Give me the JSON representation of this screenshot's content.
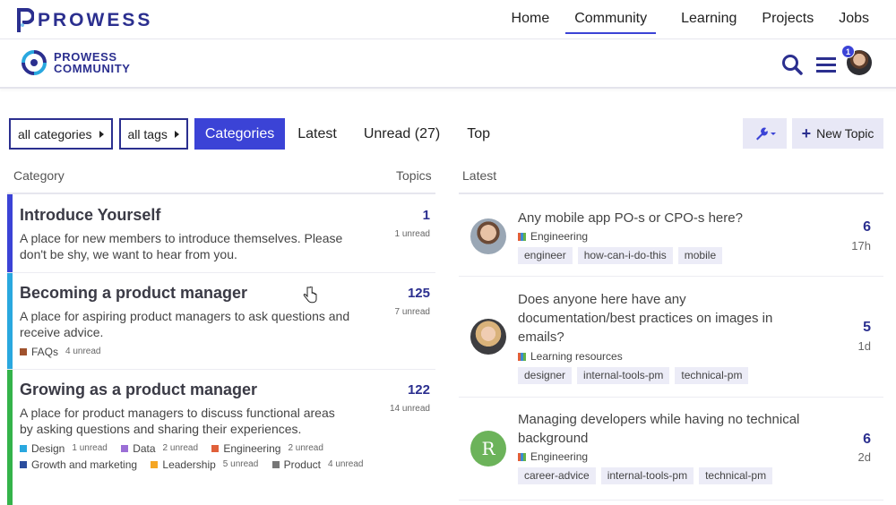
{
  "brand": {
    "name": "PROWESS"
  },
  "nav": {
    "items": [
      "Home",
      "Community",
      "Learning",
      "Projects",
      "Jobs"
    ],
    "active_index": 1
  },
  "community": {
    "logo_line1": "PROWESS",
    "logo_line2": "COMMUNITY"
  },
  "user": {
    "notification_count": "1"
  },
  "filters": {
    "categories_dropdown": "all categories",
    "tags_dropdown": "all tags",
    "tabs": [
      "Categories",
      "Latest",
      "Unread (27)",
      "Top"
    ],
    "active_tab": 0,
    "new_topic_label": "New Topic"
  },
  "columns": {
    "category": "Category",
    "topics": "Topics",
    "latest": "Latest"
  },
  "categories": [
    {
      "title": "Introduce Yourself",
      "description": "A place for new members to introduce themselves. Please don't be shy, we want to hear from you.",
      "count": "1",
      "unread": "1 unread",
      "color": "#3b43d6",
      "subcategories": []
    },
    {
      "title": "Becoming a product manager",
      "description": "A place for aspiring product managers to ask questions and receive advice.",
      "count": "125",
      "unread": "7 unread",
      "color": "#2aa8df",
      "subcategories": [
        {
          "name": "FAQs",
          "unread": "4 unread",
          "color": "#a0522d"
        }
      ]
    },
    {
      "title": "Growing as a product manager",
      "description": "A place for product managers to discuss functional areas by asking questions and sharing their experiences.",
      "count": "122",
      "unread": "14 unread",
      "color": "#34b34a",
      "subcategories": [
        {
          "name": "Design",
          "unread": "1 unread",
          "color": "#2aa8df"
        },
        {
          "name": "Data",
          "unread": "2 unread",
          "color": "#9b6fd6"
        },
        {
          "name": "Engineering",
          "unread": "2 unread",
          "color": "#e0603a"
        },
        {
          "name": "Growth and marketing",
          "unread": "",
          "color": "#2b4e9e"
        },
        {
          "name": "Leadership",
          "unread": "5 unread",
          "color": "#f5a623"
        },
        {
          "name": "Product",
          "unread": "4 unread",
          "color": "#777777"
        }
      ]
    }
  ],
  "topics": [
    {
      "title": "Any mobile app PO-s or CPO-s here?",
      "category": "Engineering",
      "tags": [
        "engineer",
        "how-can-i-do-this",
        "mobile"
      ],
      "count": "6",
      "age": "17h",
      "avatar": "photo-man"
    },
    {
      "title": "Does anyone here have any documentation/best practices on images in emails?",
      "category": "Learning resources",
      "tags": [
        "designer",
        "internal-tools-pm",
        "technical-pm"
      ],
      "count": "5",
      "age": "1d",
      "avatar": "photo-woman"
    },
    {
      "title": "Managing developers while having no technical background",
      "category": "Engineering",
      "tags": [
        "career-advice",
        "internal-tools-pm",
        "technical-pm"
      ],
      "count": "6",
      "age": "2d",
      "avatar": "letter",
      "avatar_letter": "R",
      "avatar_color": "#6cb35a"
    }
  ]
}
